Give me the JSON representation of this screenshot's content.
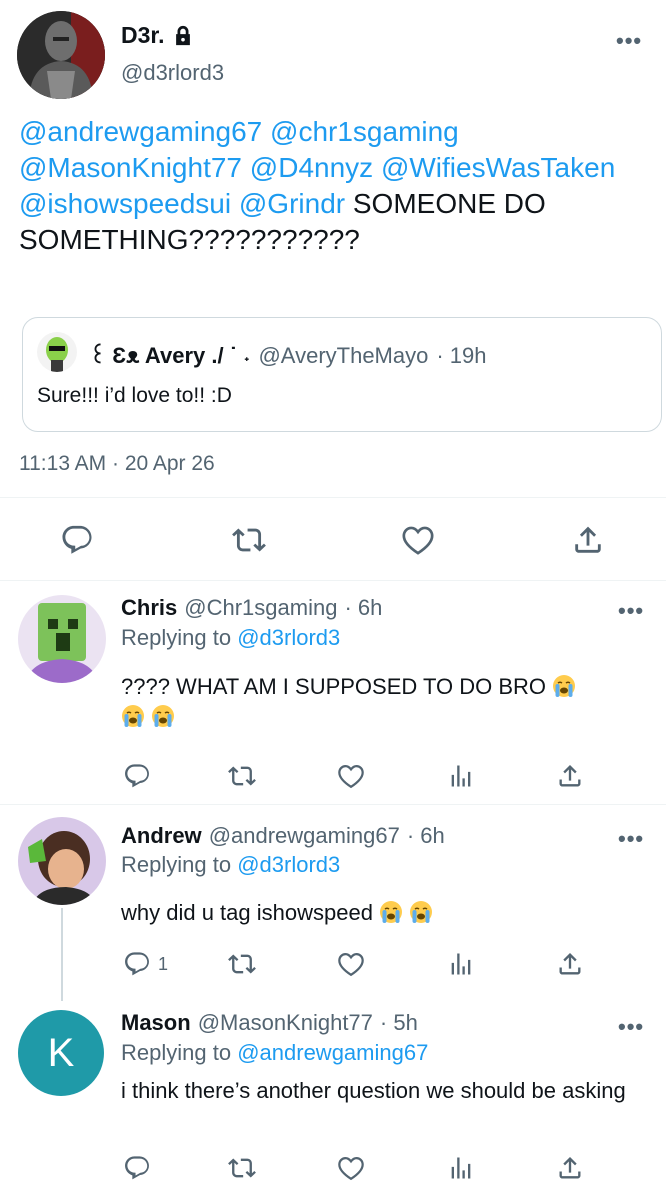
{
  "main_tweet": {
    "name": "D3r.",
    "handle": "@d3rlord3",
    "mentions": [
      "@andrewgaming67",
      "@chr1sgaming",
      "@MasonKnight77",
      "@D4nnyz",
      "@WifiesWasTaken",
      "@ishowspeedsui",
      "@Grindr"
    ],
    "text": "SOMEONE DO SOMETHING???????????",
    "time": "11:13 AM · 20 Apr 26",
    "quote": {
      "name": "꒰ Ɛᴥ  Avery ./ ˙ ˖",
      "handle": "@AveryTheMayo",
      "time": "· 19h",
      "text": "Sure!!! i’d love to!! :D"
    }
  },
  "replies": [
    {
      "name": "Chris",
      "handle": "@Chr1sgaming",
      "time": "· 6h",
      "replying_label": "Replying to",
      "replying_to": "@d3rlord3",
      "text": "???? WHAT AM I SUPPOSED TO DO BRO"
    },
    {
      "name": "Andrew",
      "handle": "@andrewgaming67",
      "time": "· 6h",
      "replying_label": "Replying to",
      "replying_to": "@d3rlord3",
      "text": "why did u tag ishowspeed",
      "reply_count": "1"
    },
    {
      "name": "Mason",
      "handle": "@MasonKnight77",
      "time": "· 5h",
      "replying_label": "Replying to",
      "replying_to": "@andrewgaming67",
      "text": "i think there’s another question we should be asking",
      "avatar_letter": "K"
    }
  ],
  "colors": {
    "accent": "#1d9bf0",
    "secondary_text": "#536471",
    "mason_avatar": "#1f9aa8"
  }
}
